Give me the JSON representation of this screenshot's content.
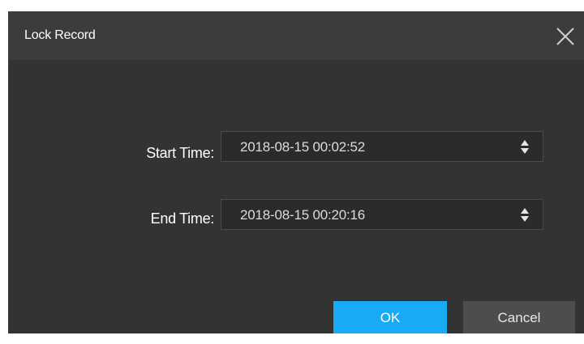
{
  "dialog": {
    "title": "Lock Record",
    "close_icon": "close-icon",
    "start_time": {
      "label": "Start Time:",
      "value": "2018-08-15 00:02:52"
    },
    "end_time": {
      "label": "End Time:",
      "value": "2018-08-15 00:20:16"
    },
    "ok_label": "OK",
    "cancel_label": "Cancel"
  },
  "colors": {
    "dialog_bg": "#333333",
    "titlebar_bg": "#3c3c3c",
    "accent": "#18aaf2",
    "secondary_button": "#4d4d4d"
  }
}
